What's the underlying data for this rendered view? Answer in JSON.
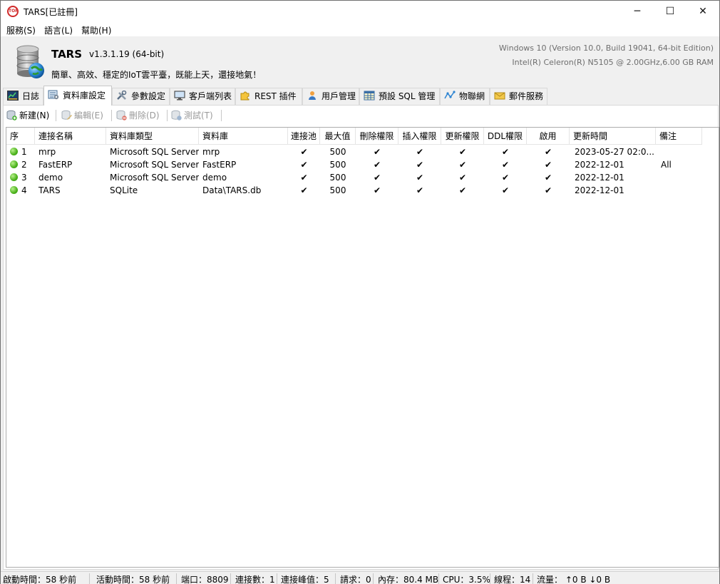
{
  "window": {
    "title": "TARS[已註冊]",
    "icon_text": "TOP",
    "controls": {
      "minimize": "─",
      "maximize": "☐",
      "close": "✕"
    }
  },
  "menu": [
    "服務(S)",
    "語言(L)",
    "幫助(H)"
  ],
  "header": {
    "app_name": "TARS",
    "version": "v1.3.1.19 (64-bit)",
    "slogan": "簡單、高效、穩定的IoT雲平臺，既能上天，還接地氣！",
    "os_info": "Windows 10 (Version 10.0, Build 19041, 64-bit Edition)",
    "hw_info": "Intel(R) Celeron(R) N5105 @ 2.00GHz,6.00 GB RAM"
  },
  "tabs": [
    {
      "label": "日誌",
      "icon": "log-icon",
      "active": false
    },
    {
      "label": "資料庫設定",
      "icon": "database-settings-icon",
      "active": true
    },
    {
      "label": "參數設定",
      "icon": "tools-icon",
      "active": false
    },
    {
      "label": "客戶端列表",
      "icon": "monitor-icon",
      "active": false
    },
    {
      "label": "REST 插件",
      "icon": "puzzle-icon",
      "active": false
    },
    {
      "label": "用戶管理",
      "icon": "user-icon",
      "active": false
    },
    {
      "label": "預設 SQL 管理",
      "icon": "table-icon",
      "active": false
    },
    {
      "label": "物聯網",
      "icon": "iot-icon",
      "active": false
    },
    {
      "label": "郵件服務",
      "icon": "mail-icon",
      "active": false
    }
  ],
  "toolbar": {
    "new": "新建(N)",
    "edit": "編輯(E)",
    "delete": "刪除(D)",
    "test": "測試(T)"
  },
  "table": {
    "columns": [
      "序",
      "連接名稱",
      "資料庫類型",
      "資料庫",
      "連接池",
      "最大值",
      "刪除權限",
      "插入權限",
      "更新權限",
      "DDL權限",
      "啟用",
      "更新時間",
      "備注"
    ],
    "check_mark": "✔",
    "rows": [
      {
        "seq": "1",
        "name": "mrp",
        "type": "Microsoft SQL Server",
        "database": "mrp",
        "pool": "✔",
        "max": "500",
        "del": "✔",
        "ins": "✔",
        "upd": "✔",
        "ddl": "✔",
        "enabled": "✔",
        "updated": "2023-05-27 02:0...",
        "note": ""
      },
      {
        "seq": "2",
        "name": "FastERP",
        "type": "Microsoft SQL Server",
        "database": "FastERP",
        "pool": "✔",
        "max": "500",
        "del": "✔",
        "ins": "✔",
        "upd": "✔",
        "ddl": "✔",
        "enabled": "✔",
        "updated": "2022-12-01",
        "note": "All"
      },
      {
        "seq": "3",
        "name": "demo",
        "type": "Microsoft SQL Server",
        "database": "demo",
        "pool": "✔",
        "max": "500",
        "del": "✔",
        "ins": "✔",
        "upd": "✔",
        "ddl": "✔",
        "enabled": "✔",
        "updated": "2022-12-01",
        "note": ""
      },
      {
        "seq": "4",
        "name": "TARS",
        "type": "SQLite",
        "database": "Data\\TARS.db",
        "pool": "✔",
        "max": "500",
        "del": "✔",
        "ins": "✔",
        "upd": "✔",
        "ddl": "✔",
        "enabled": "✔",
        "updated": "2022-12-01",
        "note": ""
      }
    ]
  },
  "status": {
    "start_time": "啟動時間：58 秒前",
    "active_time": "活動時間：58 秒前",
    "port": "端口：8809",
    "connections": "連接數：1",
    "peak": "連接峰值：5",
    "requests": "請求：0",
    "memory": "內存：80.4 MB",
    "cpu": "CPU：3.5%",
    "threads": "線程：14",
    "traffic": "流量： ↑0 B  ↓0 B"
  },
  "colors": {
    "status_dot": "#4bb21b",
    "disabled_text": "#9a9a9a",
    "system_info_text": "#6e6e6e"
  }
}
